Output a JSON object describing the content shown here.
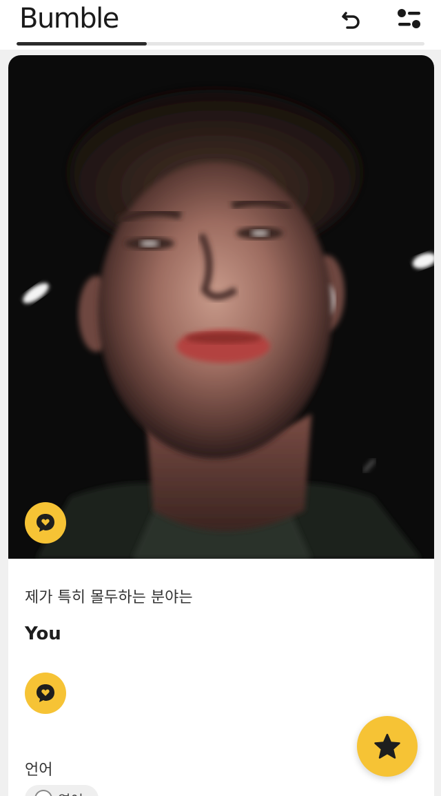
{
  "header": {
    "app_name": "Bumble",
    "undo_icon": "undo-icon",
    "filter_icon": "filter-icon",
    "progress": 0.32
  },
  "profile": {
    "photo_badge_icon": "chat-bubble-heart-icon",
    "prompt": {
      "question": "제가 특히 몰두하는 분야는",
      "answer": "You"
    },
    "prompt_badge_icon": "chat-bubble-heart-icon",
    "languages": {
      "title": "언어",
      "items": [
        "영어"
      ]
    }
  },
  "fab": {
    "icon": "star-icon"
  },
  "colors": {
    "accent": "#f6c335",
    "text_dark": "#1e1e1e"
  }
}
